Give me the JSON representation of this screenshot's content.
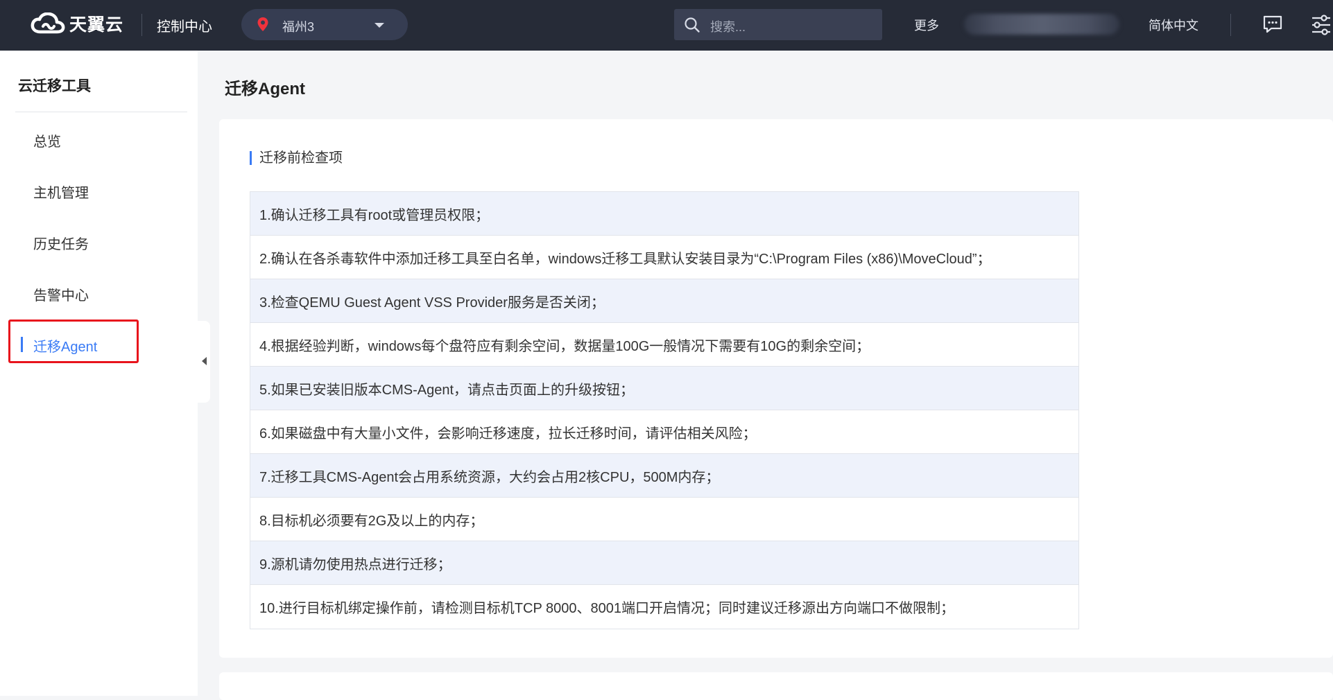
{
  "topbar": {
    "logo_text": "天翼云",
    "console_title": "控制中心",
    "region": "福州3",
    "search_placeholder": "搜索...",
    "more": "更多",
    "language": "简体中文"
  },
  "sidebar": {
    "title": "云迁移工具",
    "items": [
      {
        "label": "总览"
      },
      {
        "label": "主机管理"
      },
      {
        "label": "历史任务"
      },
      {
        "label": "告警中心"
      },
      {
        "label": "迁移Agent",
        "active": true
      }
    ]
  },
  "main": {
    "page_title": "迁移Agent",
    "section_title": "迁移前检查项",
    "checks": [
      "1.确认迁移工具有root或管理员权限；",
      "2.确认在各杀毒软件中添加迁移工具至白名单，windows迁移工具默认安装目录为“C:\\Program Files (x86)\\MoveCloud”；",
      "3.检查QEMU Guest Agent VSS Provider服务是否关闭；",
      "4.根据经验判断，windows每个盘符应有剩余空间，数据量100G一般情况下需要有10G的剩余空间；",
      "5.如果已安装旧版本CMS-Agent，请点击页面上的升级按钮；",
      "6.如果磁盘中有大量小文件，会影响迁移速度，拉长迁移时间，请评估相关风险；",
      "7.迁移工具CMS-Agent会占用系统资源，大约会占用2核CPU，500M内存；",
      "8.目标机必须要有2G及以上的内存；",
      "9.源机请勿使用热点进行迁移；",
      "10.进行目标机绑定操作前，请检测目标机TCP 8000、8001端口开启情况；同时建议迁移源出方向端口不做限制；"
    ]
  },
  "colors": {
    "topbar_bg": "#262b37",
    "accent": "#3a7bf5",
    "highlight_box": "#e8141c",
    "row_alt": "#eef2fb"
  },
  "icons": {
    "logo": "cloud-logo-icon",
    "region": "location-pin-icon",
    "search": "search-icon",
    "message": "message-icon",
    "settings": "settings-sliders-icon",
    "collapse": "collapse-left-icon"
  }
}
